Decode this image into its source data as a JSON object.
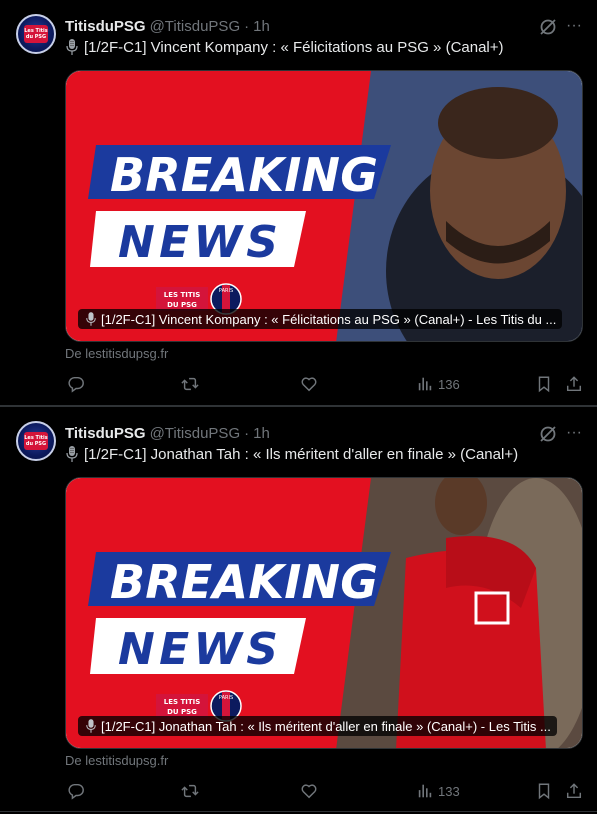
{
  "tweets": [
    {
      "author": {
        "name": "TitisduPSG",
        "handle": "@TitisduPSG",
        "time": "1h",
        "avatar_text": "Les Titis du PSG"
      },
      "text": "[1/2F-C1] Vincent Kompany : « Félicitations au PSG » (Canal+)",
      "card": {
        "headline_1": "BREAKING",
        "headline_2": "NEWS",
        "logo_text_1": "LES TITIS",
        "logo_text_2": "DU PSG",
        "logo_badge": "PARIS",
        "caption": "[1/2F-C1] Vincent Kompany : « Félicitations au PSG » (Canal+) - Les Titis du ..."
      },
      "source": "De lestitisdupsg.fr",
      "views": "136"
    },
    {
      "author": {
        "name": "TitisduPSG",
        "handle": "@TitisduPSG",
        "time": "1h",
        "avatar_text": "Les Titis du PSG"
      },
      "text": "[1/2F-C1] Jonathan Tah : « Ils méritent d'aller en finale » (Canal+)",
      "card": {
        "headline_1": "BREAKING",
        "headline_2": "NEWS",
        "logo_text_1": "LES TITIS",
        "logo_text_2": "DU PSG",
        "logo_badge": "PARIS",
        "caption": "[1/2F-C1] Jonathan Tah : « Ils méritent d'aller en finale » (Canal+) - Les Titis ..."
      },
      "source": "De lestitisdupsg.fr",
      "views": "133"
    }
  ],
  "colors": {
    "background": "#000000",
    "border": "#2f3336",
    "muted": "#71767b",
    "text": "#e7e9ea",
    "breaking_red": "#e31020",
    "banner_blue": "#1b3a9e"
  },
  "icons": [
    "grok-icon",
    "more-icon",
    "microphone-icon",
    "reply-icon",
    "retweet-icon",
    "like-icon",
    "views-icon",
    "bookmark-icon",
    "share-icon"
  ]
}
